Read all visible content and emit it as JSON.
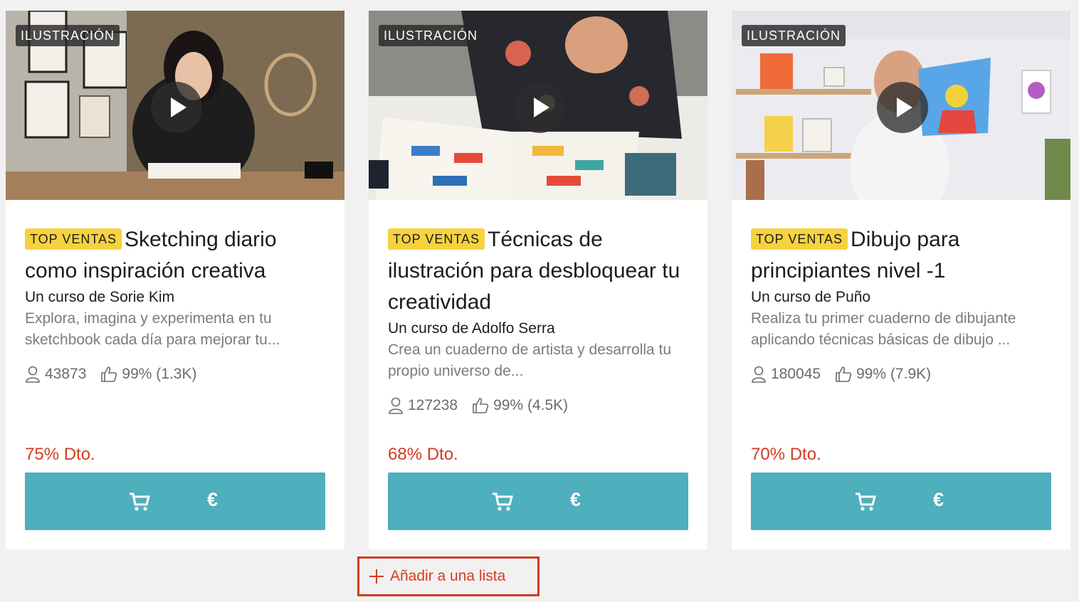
{
  "courses": [
    {
      "category": "ILUSTRACIÓN",
      "badge": "TOP VENTAS",
      "title": "Sketching diario como inspiración creativa",
      "author": "Un curso de Sorie Kim",
      "description": "Explora, imagina y experimenta en tu sketchbook cada día para mejorar tu...",
      "students": "43873",
      "rating": "99% (1.3K)",
      "discount": "75% Dto.",
      "currency": "€",
      "icons": {
        "play": "play-icon",
        "user": "user-icon",
        "like": "thumbs-up-icon",
        "cart": "cart-icon"
      }
    },
    {
      "category": "ILUSTRACIÓN",
      "badge": "TOP VENTAS",
      "title": "Técnicas de ilustración para desbloquear tu creatividad",
      "author": "Un curso de Adolfo Serra",
      "description": "Crea un cuaderno de artista y desarrolla tu propio universo de...",
      "students": "127238",
      "rating": "99% (4.5K)",
      "discount": "68% Dto.",
      "currency": "€",
      "icons": {
        "play": "play-icon",
        "user": "user-icon",
        "like": "thumbs-up-icon",
        "cart": "cart-icon"
      }
    },
    {
      "category": "ILUSTRACIÓN",
      "badge": "TOP VENTAS",
      "title": "Dibujo para principiantes nivel -1",
      "author": "Un curso de Puño",
      "description": "Realiza tu primer cuaderno de dibujante aplicando técnicas básicas de dibujo ...",
      "students": "180045",
      "rating": "99% (7.9K)",
      "discount": "70% Dto.",
      "currency": "€",
      "icons": {
        "play": "play-icon",
        "user": "user-icon",
        "like": "thumbs-up-icon",
        "cart": "cart-icon"
      }
    }
  ],
  "add_to_list": {
    "label": "Añadir a una lista",
    "icon": "plus-icon"
  },
  "colors": {
    "accent_button": "#4eafbd",
    "discount": "#d53c24",
    "top_badge": "#f6d23e",
    "highlight_border": "#d33a22"
  }
}
